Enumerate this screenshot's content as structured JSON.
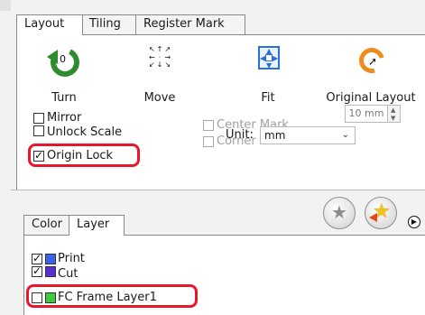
{
  "upper_tabs": [
    "Layout",
    "Tiling",
    "Register Mark"
  ],
  "tools": {
    "turn": {
      "label": "Turn",
      "icon": "turn-icon",
      "badge": "0"
    },
    "move": {
      "label": "Move",
      "icon": "move-arrows-icon"
    },
    "fit": {
      "label": "Fit",
      "icon": "fit-icon"
    },
    "original": {
      "label": "Original Layout",
      "icon": "original-layout-icon"
    }
  },
  "checkboxes": {
    "mirror": {
      "label": "Mirror",
      "checked": false
    },
    "unlock_scale": {
      "label": "Unlock Scale",
      "checked": false
    },
    "origin_lock": {
      "label": "Origin Lock",
      "checked": true
    },
    "center_mark": {
      "label": "Center Mark",
      "checked": false,
      "disabled": true
    },
    "corner_mark": {
      "label": "Corner Mark",
      "checked": false,
      "disabled": true
    }
  },
  "mark_size": {
    "value": "10 mm"
  },
  "unit": {
    "label": "Unit:",
    "value": "mm"
  },
  "lower_tabs": [
    "Color",
    "Layer"
  ],
  "layers": [
    {
      "name": "Print",
      "checked": true,
      "color": "#3a63e6"
    },
    {
      "name": "Cut",
      "checked": true,
      "color": "#5a2fd6"
    },
    {
      "name": "FC Frame Layer1",
      "checked": false,
      "color": "#3ccc3c"
    }
  ],
  "colors": {
    "highlight": "#e8182a"
  }
}
